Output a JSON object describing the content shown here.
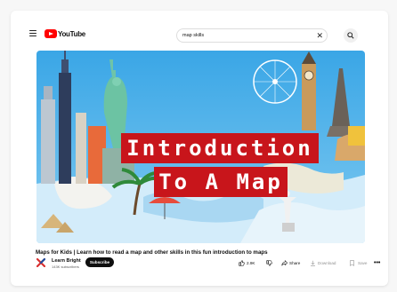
{
  "header": {
    "logo_text": "YouTube",
    "search_value": "map skills",
    "search_placeholder": "Search",
    "clear_symbol": "✕"
  },
  "video": {
    "thumbnail_title_line1": "Introduction",
    "thumbnail_title_line2": "To A Map",
    "title": "Maps for Kids | Learn how to read a map and other skills in this fun introduction to maps"
  },
  "channel": {
    "name": "Learn Bright",
    "subscribers": "143K subscribers",
    "subscribe_label": "Subscribe"
  },
  "actions": {
    "like_count": "2.9K",
    "share_label": "Share",
    "download_label": "Download",
    "save_label": "Save",
    "more_label": "•••"
  },
  "colors": {
    "brand_red": "#ff0000",
    "title_banner": "#c8151b",
    "sky": "#4fb3e8",
    "sea": "#c9e7f7"
  }
}
